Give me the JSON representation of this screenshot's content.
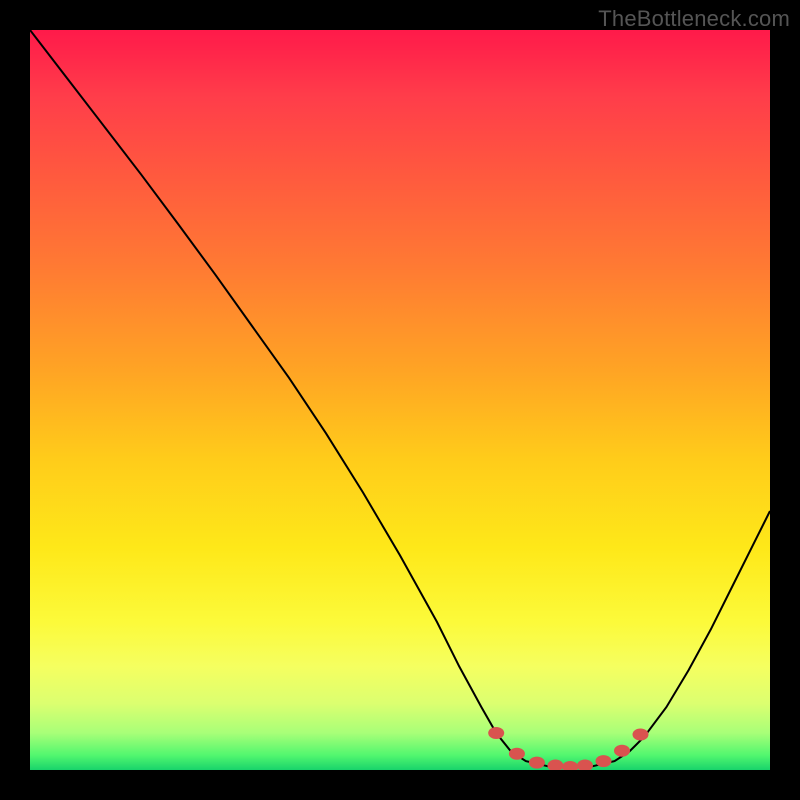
{
  "watermark": "TheBottleneck.com",
  "chart_data": {
    "type": "line",
    "title": "",
    "xlabel": "",
    "ylabel": "",
    "xlim": [
      0,
      100
    ],
    "ylim": [
      0,
      100
    ],
    "series": [
      {
        "name": "curve",
        "points": [
          {
            "x": 0.0,
            "y": 100.0
          },
          {
            "x": 5.0,
            "y": 93.5
          },
          {
            "x": 10.0,
            "y": 87.0
          },
          {
            "x": 15.0,
            "y": 80.5
          },
          {
            "x": 20.0,
            "y": 73.8
          },
          {
            "x": 25.0,
            "y": 67.0
          },
          {
            "x": 30.0,
            "y": 60.0
          },
          {
            "x": 35.0,
            "y": 53.0
          },
          {
            "x": 40.0,
            "y": 45.5
          },
          {
            "x": 45.0,
            "y": 37.5
          },
          {
            "x": 50.0,
            "y": 29.0
          },
          {
            "x": 55.0,
            "y": 20.0
          },
          {
            "x": 58.0,
            "y": 14.0
          },
          {
            "x": 61.0,
            "y": 8.5
          },
          {
            "x": 63.0,
            "y": 5.0
          },
          {
            "x": 65.0,
            "y": 2.5
          },
          {
            "x": 67.0,
            "y": 1.2
          },
          {
            "x": 70.0,
            "y": 0.5
          },
          {
            "x": 73.0,
            "y": 0.3
          },
          {
            "x": 76.0,
            "y": 0.5
          },
          {
            "x": 79.0,
            "y": 1.2
          },
          {
            "x": 81.0,
            "y": 2.5
          },
          {
            "x": 83.0,
            "y": 4.5
          },
          {
            "x": 86.0,
            "y": 8.5
          },
          {
            "x": 89.0,
            "y": 13.5
          },
          {
            "x": 92.0,
            "y": 19.0
          },
          {
            "x": 95.0,
            "y": 25.0
          },
          {
            "x": 98.0,
            "y": 31.0
          },
          {
            "x": 100.0,
            "y": 35.0
          }
        ]
      }
    ],
    "markers": [
      {
        "x": 63.0,
        "y": 5.0
      },
      {
        "x": 65.8,
        "y": 2.2
      },
      {
        "x": 68.5,
        "y": 1.0
      },
      {
        "x": 71.0,
        "y": 0.6
      },
      {
        "x": 73.0,
        "y": 0.4
      },
      {
        "x": 75.0,
        "y": 0.6
      },
      {
        "x": 77.5,
        "y": 1.2
      },
      {
        "x": 80.0,
        "y": 2.6
      },
      {
        "x": 82.5,
        "y": 4.8
      }
    ],
    "marker_color": "#d9534f",
    "curve_color": "#000000"
  }
}
